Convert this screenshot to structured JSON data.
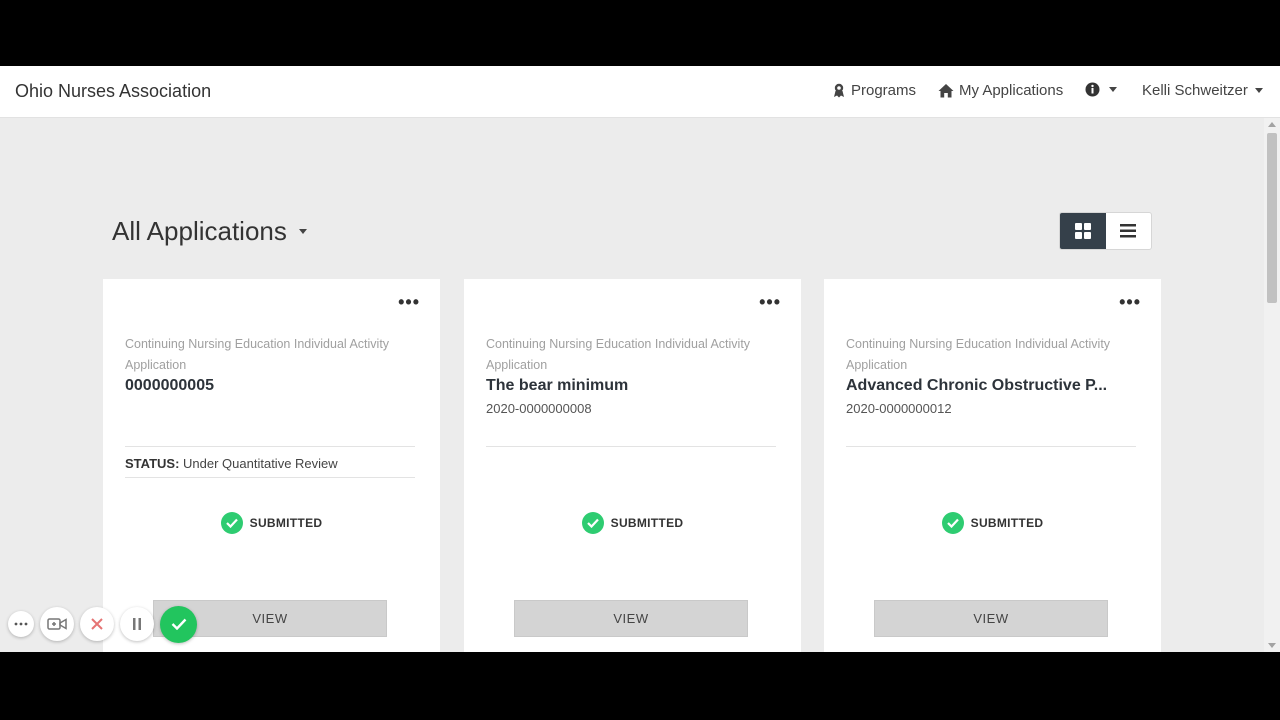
{
  "navbar": {
    "brand": "Ohio Nurses Association",
    "programs_label": "Programs",
    "my_applications_label": "My Applications",
    "user_name": "Kelli Schweitzer"
  },
  "page": {
    "title": "All Applications"
  },
  "cards": [
    {
      "type": "Continuing Nursing Education Individual Activity Application",
      "name": "0000000005",
      "id": "",
      "status_label": "STATUS:",
      "status_value": "Under Quantitative Review",
      "badge": "SUBMITTED",
      "view_label": "VIEW"
    },
    {
      "type": "Continuing Nursing Education Individual Activity Application",
      "name": "The bear minimum",
      "id": "2020-0000000008",
      "badge": "SUBMITTED",
      "view_label": "VIEW"
    },
    {
      "type": "Continuing Nursing Education Individual Activity Application",
      "name": "Advanced Chronic Obstructive P...",
      "id": "2020-0000000012",
      "badge": "SUBMITTED",
      "view_label": "VIEW"
    }
  ],
  "colors": {
    "success": "#2ecc71",
    "toggle_active": "#35404a",
    "background": "#ececec"
  },
  "icons": {
    "programs": "award-icon",
    "my_applications": "home-icon",
    "info": "info-icon",
    "grid_view": "grid-icon",
    "list_view": "list-icon",
    "submitted": "check-circle-icon"
  }
}
